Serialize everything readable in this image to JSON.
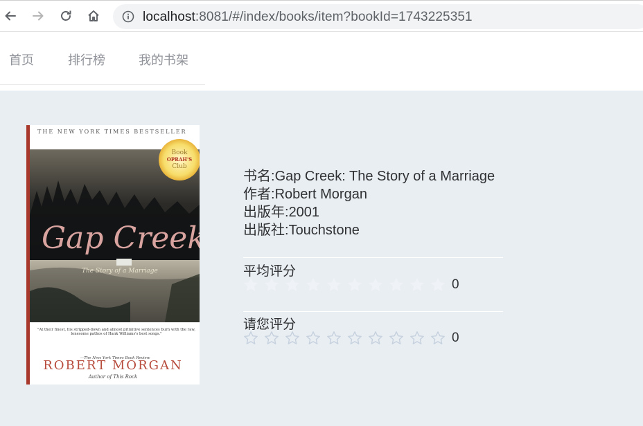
{
  "browser": {
    "url_host": "localhost",
    "url_rest": ":8081/#/index/books/item?bookId=1743225351"
  },
  "nav": {
    "items": [
      {
        "label": "首页"
      },
      {
        "label": "排行榜"
      },
      {
        "label": "我的书架"
      }
    ]
  },
  "book": {
    "title_label": "书名:",
    "title": "Gap Creek: The Story of a Marriage",
    "author_label": "作者:",
    "author": "Robert Morgan",
    "year_label": "出版年:",
    "year": "2001",
    "publisher_label": "出版社:",
    "publisher": "Touchstone",
    "cover": {
      "top_banner": "THE NEW YORK TIMES BESTSELLER",
      "badge_top": "Book",
      "badge_mid": "OPRAH'S",
      "badge_bottom": "Club",
      "title_art": "Gap Creek",
      "subtitle": "The Story of a Marriage",
      "quote": "\"At their finest, his stripped-down and almost primitive sentences burn with the raw, lonesome pathos of Hank Williams's best songs.\"",
      "quote_source": "—The New York Times Book Review",
      "author_art": "ROBERT MORGAN",
      "author_of": "Author of This Rock"
    }
  },
  "rating": {
    "average_label": "平均评分",
    "average_value": "0",
    "average_stars": 10,
    "user_label": "请您评分",
    "user_value": "0",
    "user_stars": 10,
    "star_color_inactive": "#eff2f7",
    "star_outline_color": "#c6d1de"
  }
}
